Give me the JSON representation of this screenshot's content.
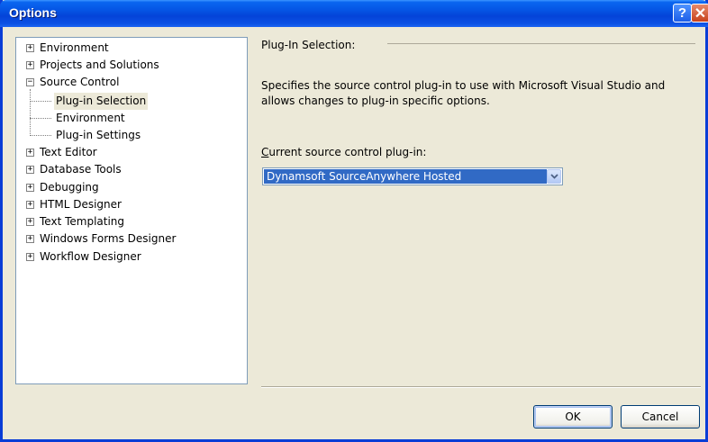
{
  "window": {
    "title": "Options",
    "help_glyph": "?",
    "close_glyph": "✕"
  },
  "tree": {
    "items": [
      {
        "label": "Environment",
        "state": "collapsed"
      },
      {
        "label": "Projects and Solutions",
        "state": "collapsed"
      },
      {
        "label": "Source Control",
        "state": "expanded"
      },
      {
        "label": "Plug-in Selection",
        "state": "selected-child"
      },
      {
        "label": "Environment",
        "state": "child"
      },
      {
        "label": "Plug-in Settings",
        "state": "child"
      },
      {
        "label": "Text Editor",
        "state": "collapsed"
      },
      {
        "label": "Database Tools",
        "state": "collapsed"
      },
      {
        "label": "Debugging",
        "state": "collapsed"
      },
      {
        "label": "HTML Designer",
        "state": "collapsed"
      },
      {
        "label": "Text Templating",
        "state": "collapsed"
      },
      {
        "label": "Windows Forms Designer",
        "state": "collapsed"
      },
      {
        "label": "Workflow Designer",
        "state": "collapsed"
      }
    ],
    "expander_collapsed": "+",
    "expander_expanded": "−"
  },
  "panel": {
    "section_title": "Plug-In Selection:",
    "description": "Specifies the source control plug-in to use with Microsoft Visual Studio and allows changes to plug-in specific options.",
    "combo_label_mnemonic": "C",
    "combo_label_rest": "urrent source control plug-in:",
    "combo_value": "Dynamsoft SourceAnywhere Hosted"
  },
  "buttons": {
    "ok": "OK",
    "cancel": "Cancel"
  },
  "colors": {
    "titlebar": "#0553e3",
    "selection": "#316ac5",
    "dialog_bg": "#ece9d8"
  }
}
